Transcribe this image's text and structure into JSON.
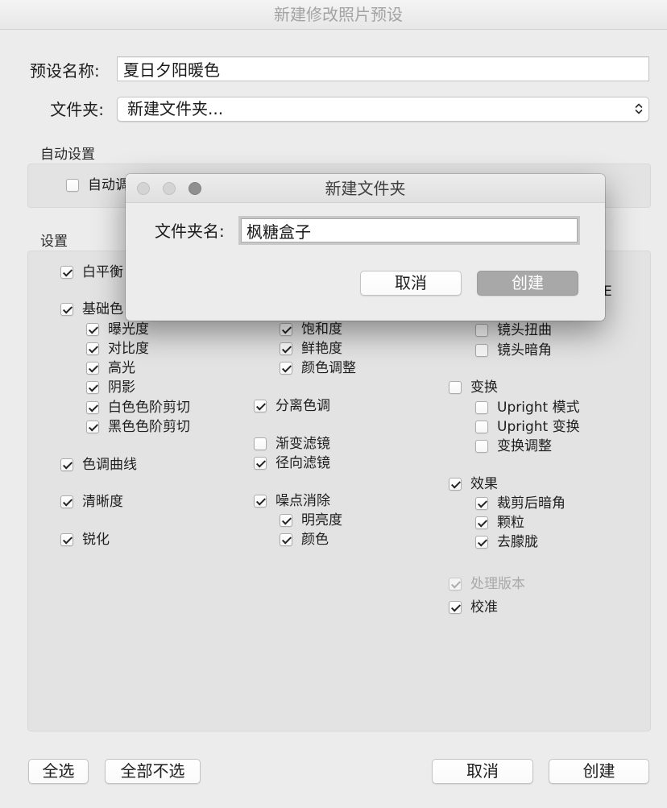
{
  "window": {
    "title": "新建修改照片预设"
  },
  "preset_name": {
    "label": "预设名称:",
    "value": "夏日夕阳暖色"
  },
  "folder": {
    "label": "文件夹:",
    "selected": "新建文件夹..."
  },
  "auto_settings": {
    "title": "自动设置",
    "items": [
      {
        "label": "自动调",
        "checked": false
      }
    ]
  },
  "settings": {
    "title": "设置",
    "col1": [
      {
        "label": "白平衡",
        "checked": true
      },
      {
        "label": "基础色",
        "checked": true
      },
      {
        "label": "曝光度",
        "checked": true
      },
      {
        "label": "对比度",
        "checked": true
      },
      {
        "label": "高光",
        "checked": true
      },
      {
        "label": "阴影",
        "checked": true
      },
      {
        "label": "白色色阶剪切",
        "checked": true
      },
      {
        "label": "黑色色阶剪切",
        "checked": true
      },
      {
        "label": "色调曲线",
        "checked": true
      },
      {
        "label": "清晰度",
        "checked": true
      },
      {
        "label": "锐化",
        "checked": true
      }
    ],
    "col2": [
      {
        "label": "饱和度",
        "checked": true
      },
      {
        "label": "鲜艳度",
        "checked": true
      },
      {
        "label": "颜色调整",
        "checked": true
      },
      {
        "label": "分离色调",
        "checked": true
      },
      {
        "label": "渐变滤镜",
        "checked": false
      },
      {
        "label": "径向滤镜",
        "checked": true
      },
      {
        "label": "噪点消除",
        "checked": true
      },
      {
        "label": "明亮度",
        "checked": true
      },
      {
        "label": "颜色",
        "checked": true
      }
    ],
    "col3": [
      {
        "label": "镜头扭曲",
        "checked": false
      },
      {
        "label": "镜头暗角",
        "checked": false
      },
      {
        "label": "变换",
        "checked": false
      },
      {
        "label": "Upright 模式",
        "checked": false
      },
      {
        "label": "Upright 变换",
        "checked": false
      },
      {
        "label": "变换调整",
        "checked": false
      },
      {
        "label": "效果",
        "checked": true
      },
      {
        "label": "裁剪后暗角",
        "checked": true
      },
      {
        "label": "颗粒",
        "checked": true
      },
      {
        "label": "去朦胧",
        "checked": true
      },
      {
        "label": "处理版本",
        "checked": true,
        "disabled": true
      },
      {
        "label": "校准",
        "checked": true
      }
    ],
    "occluded_fragment": "E"
  },
  "footer": {
    "select_all": "全选",
    "select_none": "全部不选",
    "cancel": "取消",
    "create": "创建"
  },
  "new_folder_dialog": {
    "title": "新建文件夹",
    "name_label": "文件夹名:",
    "name_value": "枫糖盒子",
    "cancel": "取消",
    "create": "创建"
  },
  "colors": {
    "window_bg": "#ececec",
    "group_bg": "#e3e3e3",
    "default_button_bg": "#a8a8a8",
    "focus_ring": "#c8c8c8",
    "disabled_text": "#a9a9a9"
  },
  "icons": {
    "folder_popup": "chevron-up-down-icon",
    "checkbox_mark": "checkmark-icon",
    "dialog_controls": [
      "close-button-icon",
      "minimize-button-icon",
      "zoom-button-icon"
    ]
  }
}
